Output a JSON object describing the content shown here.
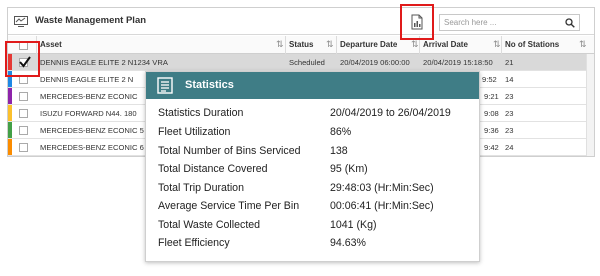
{
  "header": {
    "title": "Waste Management Plan"
  },
  "search": {
    "placeholder": "Search here ..."
  },
  "table": {
    "columns": [
      "Asset",
      "Status",
      "Departure Date",
      "Arrival Date",
      "No of Stations"
    ],
    "rows": [
      {
        "selected": true,
        "strip": "#e53935",
        "asset": "DENNIS EAGLE ELITE 2 N1234 VRA",
        "status": "Scheduled",
        "departure": "20/04/2019  06:00:00",
        "arrival": "20/04/2019  15:18:50",
        "stations": "21"
      },
      {
        "selected": false,
        "strip": "#1e88e5",
        "asset": "DENNIS EAGLE ELITE 2 N",
        "status": "",
        "departure": "",
        "arrival": "9:52",
        "stations": "14"
      },
      {
        "selected": false,
        "strip": "#8e24aa",
        "asset": "MERCEDES-BENZ ECONIC",
        "status": "",
        "departure": "",
        "arrival": "9:21",
        "stations": "23"
      },
      {
        "selected": false,
        "strip": "#fbc02d",
        "asset": "ISUZU FORWARD N44. 180",
        "status": "",
        "departure": "",
        "arrival": "9:08",
        "stations": "23"
      },
      {
        "selected": false,
        "strip": "#43a047",
        "asset": "MERCEDES-BENZ ECONIC 5",
        "status": "",
        "departure": "",
        "arrival": "9:36",
        "stations": "23"
      },
      {
        "selected": false,
        "strip": "#fb8c00",
        "asset": "MERCEDES-BENZ ECONIC 6",
        "status": "",
        "departure": "",
        "arrival": "9:42",
        "stations": "24"
      }
    ]
  },
  "statistics": {
    "title": "Statistics",
    "items": [
      {
        "label": "Statistics Duration",
        "value": "20/04/2019 to 26/04/2019"
      },
      {
        "label": "Fleet Utilization",
        "value": "86%"
      },
      {
        "label": "Total Number of Bins Serviced",
        "value": "138"
      },
      {
        "label": "Total Distance Covered",
        "value": "95 (Km)"
      },
      {
        "label": "Total Trip Duration",
        "value": "29:48:03 (Hr:Min:Sec)"
      },
      {
        "label": "Average Service Time Per Bin",
        "value": "00:06:41 (Hr:Min:Sec)"
      },
      {
        "label": "Total Waste Collected",
        "value": "1041 (Kg)"
      },
      {
        "label": "Fleet Efficiency",
        "value": "94.63%"
      }
    ]
  },
  "colors": {
    "accent": "#3f7d86",
    "highlight": "#e01a1a",
    "selected_row": "#d9d9d9"
  },
  "icons": {
    "title": "monitor-icon",
    "report": "report-document-icon",
    "search": "search-icon",
    "check": "checkmark-icon",
    "stats": "statistics-document-icon"
  }
}
